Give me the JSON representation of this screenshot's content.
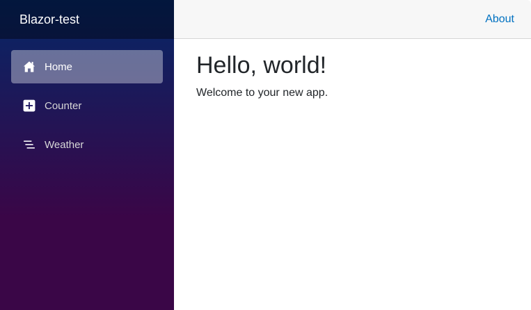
{
  "sidebar": {
    "brand": "Blazor-test",
    "items": [
      {
        "label": "Home",
        "icon": "house-icon",
        "active": true
      },
      {
        "label": "Counter",
        "icon": "plus-square-icon",
        "active": false
      },
      {
        "label": "Weather",
        "icon": "list-icon",
        "active": false
      }
    ]
  },
  "header": {
    "about_label": "About"
  },
  "main": {
    "title": "Hello, world!",
    "welcome": "Welcome to your new app."
  },
  "colors": {
    "sidebar_top": "#052767",
    "sidebar_bottom": "#3a0647",
    "active_item_bg": "#7a7ea8",
    "link": "#0071c1",
    "header_bg": "#f7f7f7"
  }
}
